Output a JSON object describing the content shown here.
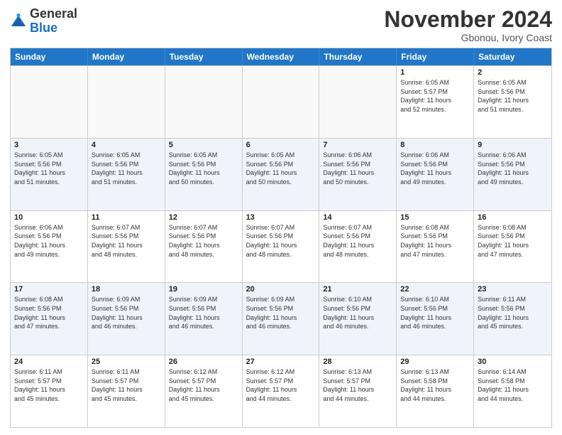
{
  "header": {
    "logo_general": "General",
    "logo_blue": "Blue",
    "month_title": "November 2024",
    "location": "Gbonou, Ivory Coast"
  },
  "weekdays": [
    "Sunday",
    "Monday",
    "Tuesday",
    "Wednesday",
    "Thursday",
    "Friday",
    "Saturday"
  ],
  "rows": [
    {
      "alt": false,
      "cells": [
        {
          "day": "",
          "info": ""
        },
        {
          "day": "",
          "info": ""
        },
        {
          "day": "",
          "info": ""
        },
        {
          "day": "",
          "info": ""
        },
        {
          "day": "",
          "info": ""
        },
        {
          "day": "1",
          "info": "Sunrise: 6:05 AM\nSunset: 5:57 PM\nDaylight: 11 hours\nand 52 minutes."
        },
        {
          "day": "2",
          "info": "Sunrise: 6:05 AM\nSunset: 5:56 PM\nDaylight: 11 hours\nand 51 minutes."
        }
      ]
    },
    {
      "alt": true,
      "cells": [
        {
          "day": "3",
          "info": "Sunrise: 6:05 AM\nSunset: 5:56 PM\nDaylight: 11 hours\nand 51 minutes."
        },
        {
          "day": "4",
          "info": "Sunrise: 6:05 AM\nSunset: 5:56 PM\nDaylight: 11 hours\nand 51 minutes."
        },
        {
          "day": "5",
          "info": "Sunrise: 6:05 AM\nSunset: 5:56 PM\nDaylight: 11 hours\nand 50 minutes."
        },
        {
          "day": "6",
          "info": "Sunrise: 6:05 AM\nSunset: 5:56 PM\nDaylight: 11 hours\nand 50 minutes."
        },
        {
          "day": "7",
          "info": "Sunrise: 6:06 AM\nSunset: 5:56 PM\nDaylight: 11 hours\nand 50 minutes."
        },
        {
          "day": "8",
          "info": "Sunrise: 6:06 AM\nSunset: 5:56 PM\nDaylight: 11 hours\nand 49 minutes."
        },
        {
          "day": "9",
          "info": "Sunrise: 6:06 AM\nSunset: 5:56 PM\nDaylight: 11 hours\nand 49 minutes."
        }
      ]
    },
    {
      "alt": false,
      "cells": [
        {
          "day": "10",
          "info": "Sunrise: 6:06 AM\nSunset: 5:56 PM\nDaylight: 11 hours\nand 49 minutes."
        },
        {
          "day": "11",
          "info": "Sunrise: 6:07 AM\nSunset: 5:56 PM\nDaylight: 11 hours\nand 48 minutes."
        },
        {
          "day": "12",
          "info": "Sunrise: 6:07 AM\nSunset: 5:56 PM\nDaylight: 11 hours\nand 48 minutes."
        },
        {
          "day": "13",
          "info": "Sunrise: 6:07 AM\nSunset: 5:56 PM\nDaylight: 11 hours\nand 48 minutes."
        },
        {
          "day": "14",
          "info": "Sunrise: 6:07 AM\nSunset: 5:56 PM\nDaylight: 11 hours\nand 48 minutes."
        },
        {
          "day": "15",
          "info": "Sunrise: 6:08 AM\nSunset: 5:56 PM\nDaylight: 11 hours\nand 47 minutes."
        },
        {
          "day": "16",
          "info": "Sunrise: 6:08 AM\nSunset: 5:56 PM\nDaylight: 11 hours\nand 47 minutes."
        }
      ]
    },
    {
      "alt": true,
      "cells": [
        {
          "day": "17",
          "info": "Sunrise: 6:08 AM\nSunset: 5:56 PM\nDaylight: 11 hours\nand 47 minutes."
        },
        {
          "day": "18",
          "info": "Sunrise: 6:09 AM\nSunset: 5:56 PM\nDaylight: 11 hours\nand 46 minutes."
        },
        {
          "day": "19",
          "info": "Sunrise: 6:09 AM\nSunset: 5:56 PM\nDaylight: 11 hours\nand 46 minutes."
        },
        {
          "day": "20",
          "info": "Sunrise: 6:09 AM\nSunset: 5:56 PM\nDaylight: 11 hours\nand 46 minutes."
        },
        {
          "day": "21",
          "info": "Sunrise: 6:10 AM\nSunset: 5:56 PM\nDaylight: 11 hours\nand 46 minutes."
        },
        {
          "day": "22",
          "info": "Sunrise: 6:10 AM\nSunset: 5:56 PM\nDaylight: 11 hours\nand 46 minutes."
        },
        {
          "day": "23",
          "info": "Sunrise: 6:11 AM\nSunset: 5:56 PM\nDaylight: 11 hours\nand 45 minutes."
        }
      ]
    },
    {
      "alt": false,
      "cells": [
        {
          "day": "24",
          "info": "Sunrise: 6:11 AM\nSunset: 5:57 PM\nDaylight: 11 hours\nand 45 minutes."
        },
        {
          "day": "25",
          "info": "Sunrise: 6:11 AM\nSunset: 5:57 PM\nDaylight: 11 hours\nand 45 minutes."
        },
        {
          "day": "26",
          "info": "Sunrise: 6:12 AM\nSunset: 5:57 PM\nDaylight: 11 hours\nand 45 minutes."
        },
        {
          "day": "27",
          "info": "Sunrise: 6:12 AM\nSunset: 5:57 PM\nDaylight: 11 hours\nand 44 minutes."
        },
        {
          "day": "28",
          "info": "Sunrise: 6:13 AM\nSunset: 5:57 PM\nDaylight: 11 hours\nand 44 minutes."
        },
        {
          "day": "29",
          "info": "Sunrise: 6:13 AM\nSunset: 5:58 PM\nDaylight: 11 hours\nand 44 minutes."
        },
        {
          "day": "30",
          "info": "Sunrise: 6:14 AM\nSunset: 5:58 PM\nDaylight: 11 hours\nand 44 minutes."
        }
      ]
    }
  ]
}
